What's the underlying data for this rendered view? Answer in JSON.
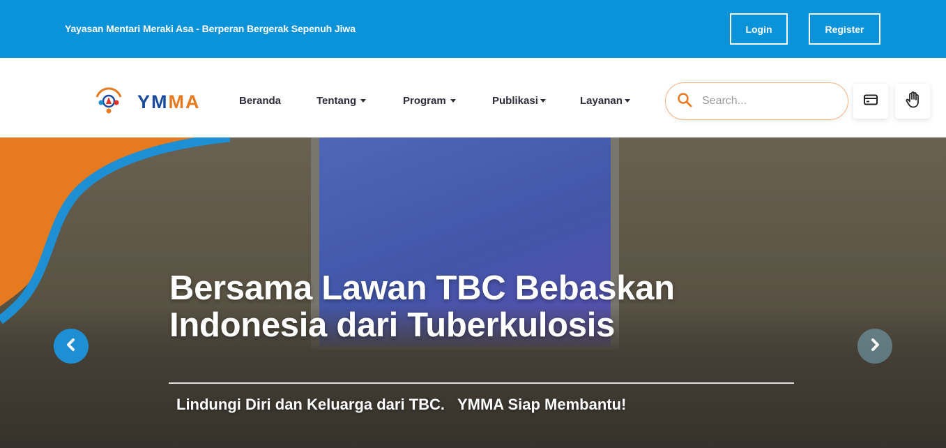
{
  "topbar": {
    "tagline": "Yayasan Mentari Meraki Asa - Berperan Bergerak Sepenuh Jiwa",
    "login_label": "Login",
    "register_label": "Register",
    "background": "#0b93da"
  },
  "navbar": {
    "logo": {
      "text_part1": "YM",
      "text_part2": "MA",
      "icon": "ymma-logo-icon"
    },
    "items": [
      {
        "label": "Beranda",
        "has_dropdown": false
      },
      {
        "label": "Tentang",
        "has_dropdown": true
      },
      {
        "label": "Program",
        "has_dropdown": true
      },
      {
        "label": "Publikasi",
        "has_dropdown": true
      },
      {
        "label": "Layanan",
        "has_dropdown": true
      }
    ],
    "search": {
      "placeholder": "Search...",
      "value": "",
      "icon": "search-icon"
    },
    "icon_buttons": [
      {
        "icon": "credit-card-icon"
      },
      {
        "icon": "hand-icon"
      }
    ]
  },
  "hero": {
    "title": "Bersama Lawan TBC Bebaskan Indonesia dari Tuberkulosis",
    "subtitle": "Lindungi Diri dan Keluarga dari TBC.   YMMA Siap Membantu!",
    "prev_icon": "chevron-left-icon",
    "next_icon": "chevron-right-icon"
  },
  "colors": {
    "accent_orange": "#e67a1f",
    "accent_blue": "#1f8fd3",
    "brand_dark_blue": "#1a4a9c"
  }
}
